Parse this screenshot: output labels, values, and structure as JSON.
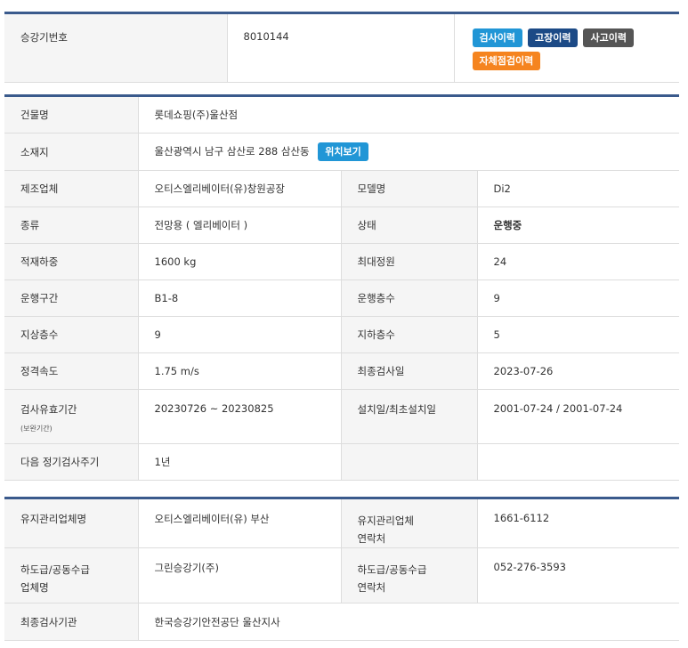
{
  "header": {
    "label": "승강기번호",
    "value": "8010144",
    "buttons": {
      "inspection_history": "검사이력",
      "fault_history": "고장이력",
      "accident_history": "사고이력",
      "self_check_history": "자체점검이력"
    },
    "colors": {
      "inspection": "#2196d6",
      "fault": "#1c4a86",
      "accident": "#555555",
      "self_check": "#f5841f"
    }
  },
  "info": {
    "building_label": "건물명",
    "building_value": "롯데쇼핑(주)울산점",
    "address_label": "소재지",
    "address_value": "울산광역시 남구 삼산로 288 삼산동",
    "map_button": "위치보기",
    "rows": [
      {
        "l1": "제조업체",
        "v1": "오티스엘리베이터(유)창원공장",
        "l2": "모델명",
        "v2": "Di2"
      },
      {
        "l1": "종류",
        "v1": "전망용 ( 엘리베이터 )",
        "l2": "상태",
        "v2": "운행중"
      },
      {
        "l1": "적재하중",
        "v1": "1600 kg",
        "l2": "최대정원",
        "v2": "24"
      },
      {
        "l1": "운행구간",
        "v1": "B1-8",
        "l2": "운행층수",
        "v2": "9"
      },
      {
        "l1": "지상층수",
        "v1": "9",
        "l2": "지하층수",
        "v2": "5"
      },
      {
        "l1": "정격속도",
        "v1": "1.75 m/s",
        "l2": "최종검사일",
        "v2": "2023-07-26"
      },
      {
        "l1": "검사유효기간",
        "l1_sub": "(보완기간)",
        "v1": "20230726 ~ 20230825",
        "l2": "설치일/최초설치일",
        "v2": "2001-07-24 / 2001-07-24"
      }
    ],
    "next_cycle_label": "다음 정기검사주기",
    "next_cycle_value": "1년"
  },
  "maintenance": {
    "company_label": "유지관리업체명",
    "company_value": "오티스엘리베이터(유) 부산",
    "contact_label_1": "유지관리업체",
    "contact_label_2": "연락처",
    "contact_value": "1661-6112",
    "sub_label_1": "하도급/공동수급",
    "sub_label_2": "업체명",
    "sub_value": "그린승강기(주)",
    "sub_contact_label_1": "하도급/공동수급",
    "sub_contact_label_2": "연락처",
    "sub_contact_value": "052-276-3593",
    "agency_label": "최종검사기관",
    "agency_value": "한국승강기안전공단 울산지사"
  }
}
